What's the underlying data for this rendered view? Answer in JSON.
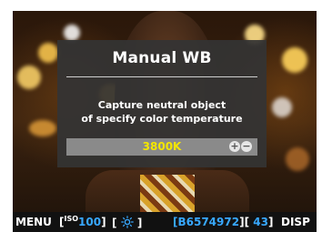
{
  "dialog": {
    "title": "Manual WB",
    "message_line1": "Capture neutral object",
    "message_line2": "of specify color temperature",
    "value": "3800K",
    "plus_icon": "plus-circle-icon",
    "minus_icon": "minus-circle-icon"
  },
  "status_bar": {
    "menu_label": "MENU",
    "iso_label": "ISO",
    "iso_value": "100",
    "wb_icon": "wb-sun-icon",
    "serial_open": "[",
    "serial_value": "B6574972",
    "serial_close": "][",
    "count_value": "43",
    "count_close": "]",
    "disp_label": "DISP"
  },
  "colors": {
    "value_text": "#f3e600",
    "status_accent": "#38a8ff"
  }
}
